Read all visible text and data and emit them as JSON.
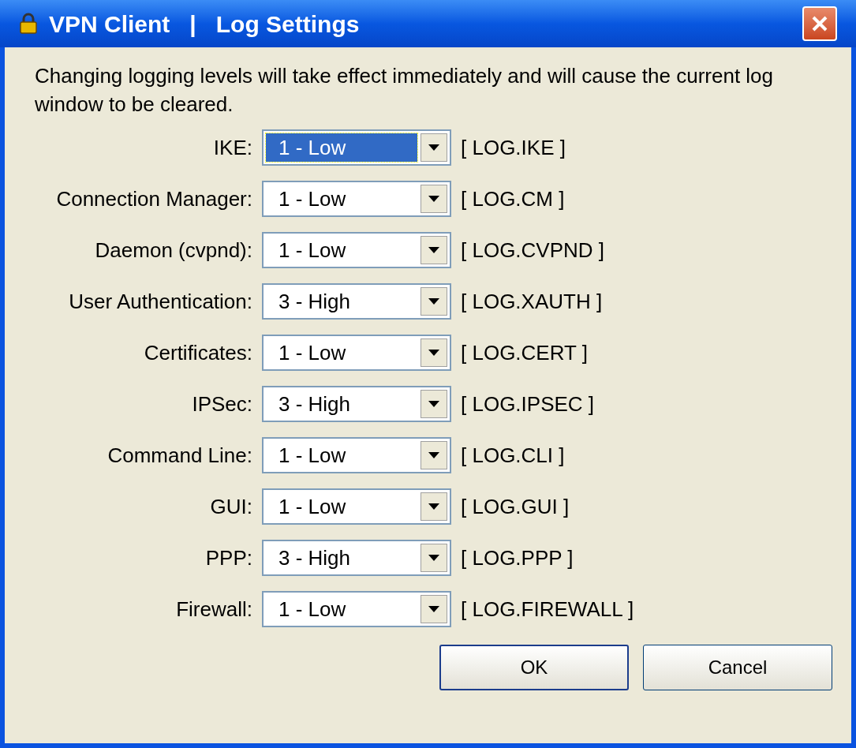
{
  "window": {
    "title": "VPN Client   |   Log Settings"
  },
  "message": "Changing logging levels will take effect immediately and will cause the current log window to be cleared.",
  "settings": [
    {
      "label": "IKE:",
      "value": "1 - Low",
      "tag": "[ LOG.IKE ]",
      "focused": true
    },
    {
      "label": "Connection Manager:",
      "value": "1 - Low",
      "tag": "[ LOG.CM ]",
      "focused": false
    },
    {
      "label": "Daemon (cvpnd):",
      "value": "1 - Low",
      "tag": "[ LOG.CVPND ]",
      "focused": false
    },
    {
      "label": "User Authentication:",
      "value": "3 - High",
      "tag": "[ LOG.XAUTH ]",
      "focused": false
    },
    {
      "label": "Certificates:",
      "value": "1 - Low",
      "tag": "[ LOG.CERT ]",
      "focused": false
    },
    {
      "label": "IPSec:",
      "value": "3 - High",
      "tag": "[ LOG.IPSEC ]",
      "focused": false
    },
    {
      "label": "Command Line:",
      "value": "1 - Low",
      "tag": "[ LOG.CLI ]",
      "focused": false
    },
    {
      "label": "GUI:",
      "value": "1 - Low",
      "tag": "[ LOG.GUI ]",
      "focused": false
    },
    {
      "label": "PPP:",
      "value": "3 - High",
      "tag": "[ LOG.PPP ]",
      "focused": false
    },
    {
      "label": "Firewall:",
      "value": "1 - Low",
      "tag": "[ LOG.FIREWALL ]",
      "focused": false
    }
  ],
  "buttons": [
    {
      "label": "OK",
      "default": true
    },
    {
      "label": "Cancel",
      "default": false
    }
  ]
}
